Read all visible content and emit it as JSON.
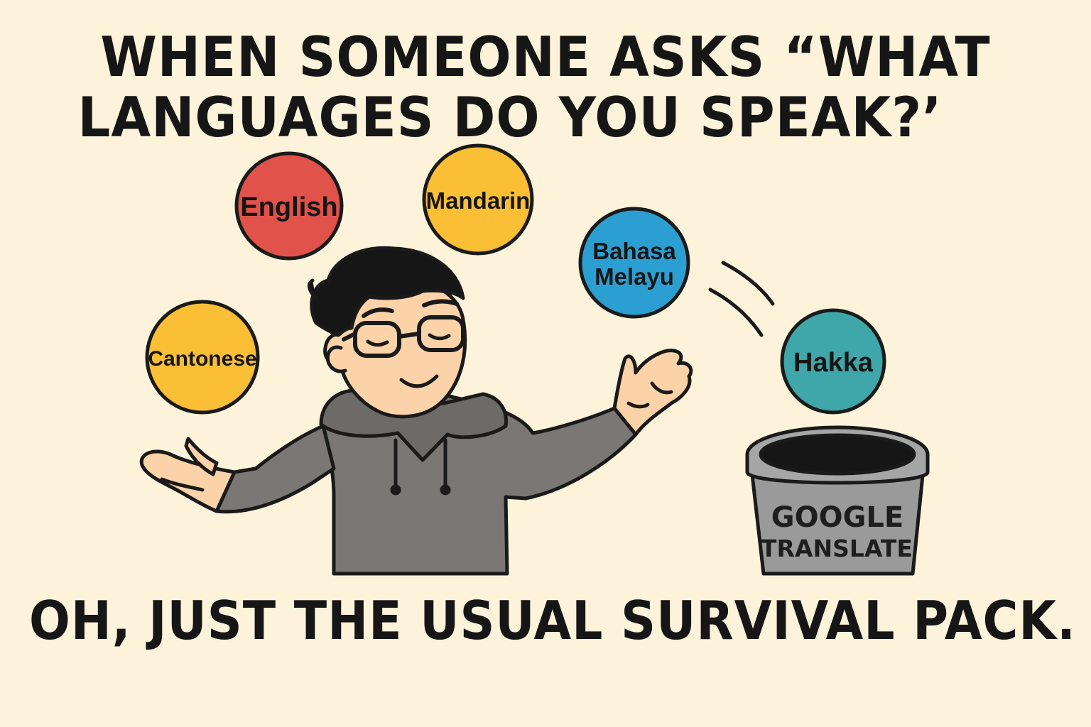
{
  "title": {
    "line1": "WHEN SOMEONE ASKS “WHAT",
    "line2": "LANGUAGES DO YOU SPEAK?’"
  },
  "caption": "OH, JUST THE USUAL SURVIVAL PACK.",
  "bubbles": {
    "english": "English",
    "mandarin": "Mandarin",
    "cantonese": "Cantonese",
    "bahasa_line1": "Bahasa",
    "bahasa_line2": "Melayu",
    "hakka": "Hakka"
  },
  "bucket": {
    "line1": "GOOGLE",
    "line2": "TRANSLATE"
  },
  "colors": {
    "background": "#fcf3da",
    "english": "#e0524a",
    "mandarin": "#fbbf35",
    "cantonese": "#fbbf35",
    "bahasa_melayu": "#2b9fd1",
    "hakka": "#3fa6a9",
    "hoodie": "#7a7774",
    "skin": "#fcd3a8",
    "bucket": "#9a9a9a"
  }
}
